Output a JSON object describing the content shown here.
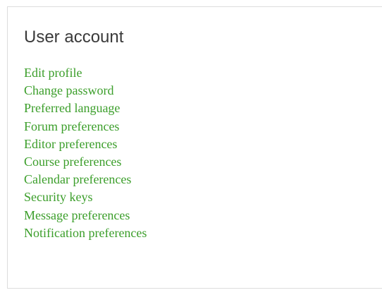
{
  "card": {
    "title": "User account",
    "links": [
      {
        "label": "Edit profile"
      },
      {
        "label": "Change password"
      },
      {
        "label": "Preferred language"
      },
      {
        "label": "Forum preferences"
      },
      {
        "label": "Editor preferences"
      },
      {
        "label": "Course preferences"
      },
      {
        "label": "Calendar preferences"
      },
      {
        "label": "Security keys"
      },
      {
        "label": "Message preferences"
      },
      {
        "label": "Notification preferences"
      }
    ]
  },
  "colors": {
    "link": "#3b9e2a",
    "title": "#3a3a3a",
    "border": "#dcdcdc"
  }
}
